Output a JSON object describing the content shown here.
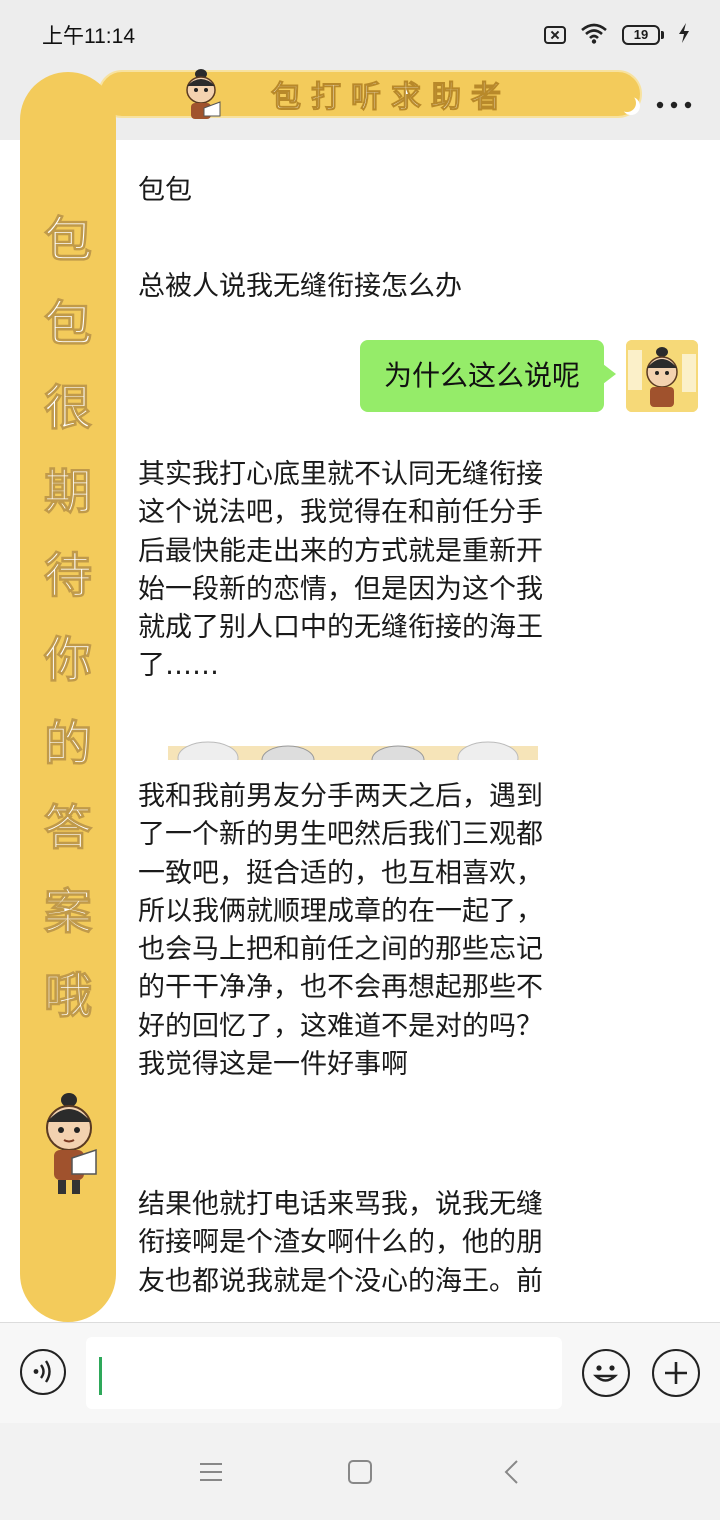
{
  "status": {
    "time": "上午11:14",
    "battery": "19",
    "icons": [
      "sim-blocked-icon",
      "wifi-icon",
      "battery-icon",
      "charging-icon"
    ]
  },
  "nav": {
    "back_icon": "chevron-left-icon",
    "title": "包打听求助者",
    "more_icon": "more-icon"
  },
  "side_banner": {
    "characters": [
      "包",
      "包",
      "很",
      "期",
      "待",
      "你",
      "的",
      "答",
      "案",
      "哦"
    ]
  },
  "messages": [
    {
      "type": "text",
      "text": "包包"
    },
    {
      "type": "text",
      "text": "总被人说我无缝衔接怎么办"
    },
    {
      "type": "bubble",
      "text": "为什么这么说呢"
    }
  ],
  "paragraphs": [
    {
      "lines": [
        "其实我打心底里就不认同无缝衔接",
        "这个说法吧，我觉得在和前任分手",
        "后最快能走出来的方式就是重新开",
        "始一段新的恋情，但是因为这个我",
        "就成了别人口中的无缝衔接的海王",
        "了……"
      ]
    },
    {
      "lines": [
        "我和我前男友分手两天之后，遇到",
        "了一个新的男生吧然后我们三观都",
        "一致吧，挺合适的，也互相喜欢，",
        "所以我俩就顺理成章的在一起了，",
        "也会马上把和前任之间的那些忘记",
        "的干干净净，也不会再想起那些不",
        "好的回忆了，这难道不是对的吗？",
        "我觉得这是一件好事啊"
      ]
    },
    {
      "lines": [
        "结果他就打电话来骂我，说我无缝",
        "衔接啊是个渣女啊什么的，他的朋",
        "友也都说我就是个没心的海王。前"
      ]
    }
  ],
  "input_bar": {
    "placeholder": "",
    "voice_icon": "voice-icon",
    "emoji_icon": "emoji-icon",
    "plus_icon": "plus-icon"
  },
  "system_nav": [
    "menu-icon",
    "home-icon",
    "back-icon"
  ],
  "colors": {
    "banner": "#f3cb5b",
    "bubble": "#95ec69",
    "background": "#ededed",
    "chat_bg": "#ffffff"
  }
}
